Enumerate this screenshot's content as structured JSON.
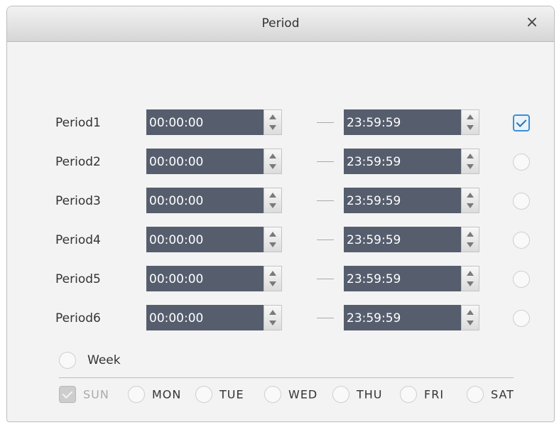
{
  "dialog": {
    "title": "Period",
    "close_glyph": "×"
  },
  "periods": [
    {
      "label": "Period1",
      "start": "00:00:00",
      "end": "23:59:59",
      "checked": true
    },
    {
      "label": "Period2",
      "start": "00:00:00",
      "end": "23:59:59",
      "checked": false
    },
    {
      "label": "Period3",
      "start": "00:00:00",
      "end": "23:59:59",
      "checked": false
    },
    {
      "label": "Period4",
      "start": "00:00:00",
      "end": "23:59:59",
      "checked": false
    },
    {
      "label": "Period5",
      "start": "00:00:00",
      "end": "23:59:59",
      "checked": false
    },
    {
      "label": "Period6",
      "start": "00:00:00",
      "end": "23:59:59",
      "checked": false
    }
  ],
  "week": {
    "label": "Week"
  },
  "days": [
    {
      "label": "SUN",
      "checked": true,
      "disabled": true
    },
    {
      "label": "MON",
      "checked": false,
      "disabled": false
    },
    {
      "label": "TUE",
      "checked": false,
      "disabled": false
    },
    {
      "label": "WED",
      "checked": false,
      "disabled": false
    },
    {
      "label": "THU",
      "checked": false,
      "disabled": false
    },
    {
      "label": "FRI",
      "checked": false,
      "disabled": false
    },
    {
      "label": "SAT",
      "checked": false,
      "disabled": false
    }
  ],
  "colors": {
    "field_bg": "#565e6e",
    "accent": "#3a8fd6"
  }
}
